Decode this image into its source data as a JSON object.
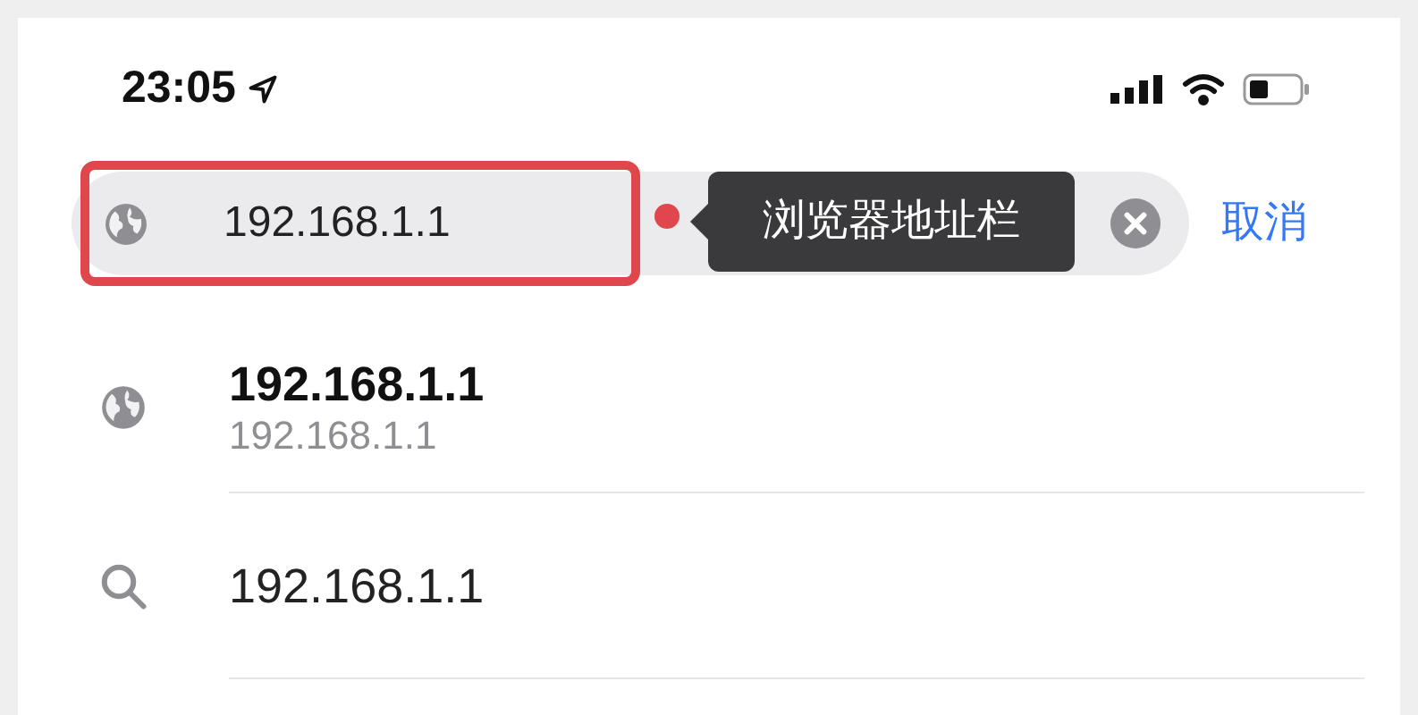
{
  "status_bar": {
    "time": "23:05"
  },
  "address_bar": {
    "value": "192.168.1.1",
    "highlighted": true,
    "annotation": "浏览器地址栏"
  },
  "cancel": "取消",
  "suggestions": [
    {
      "kind": "site",
      "title": "192.168.1.1",
      "subtitle": "192.168.1.1"
    },
    {
      "kind": "search",
      "title": "192.168.1.1"
    }
  ]
}
